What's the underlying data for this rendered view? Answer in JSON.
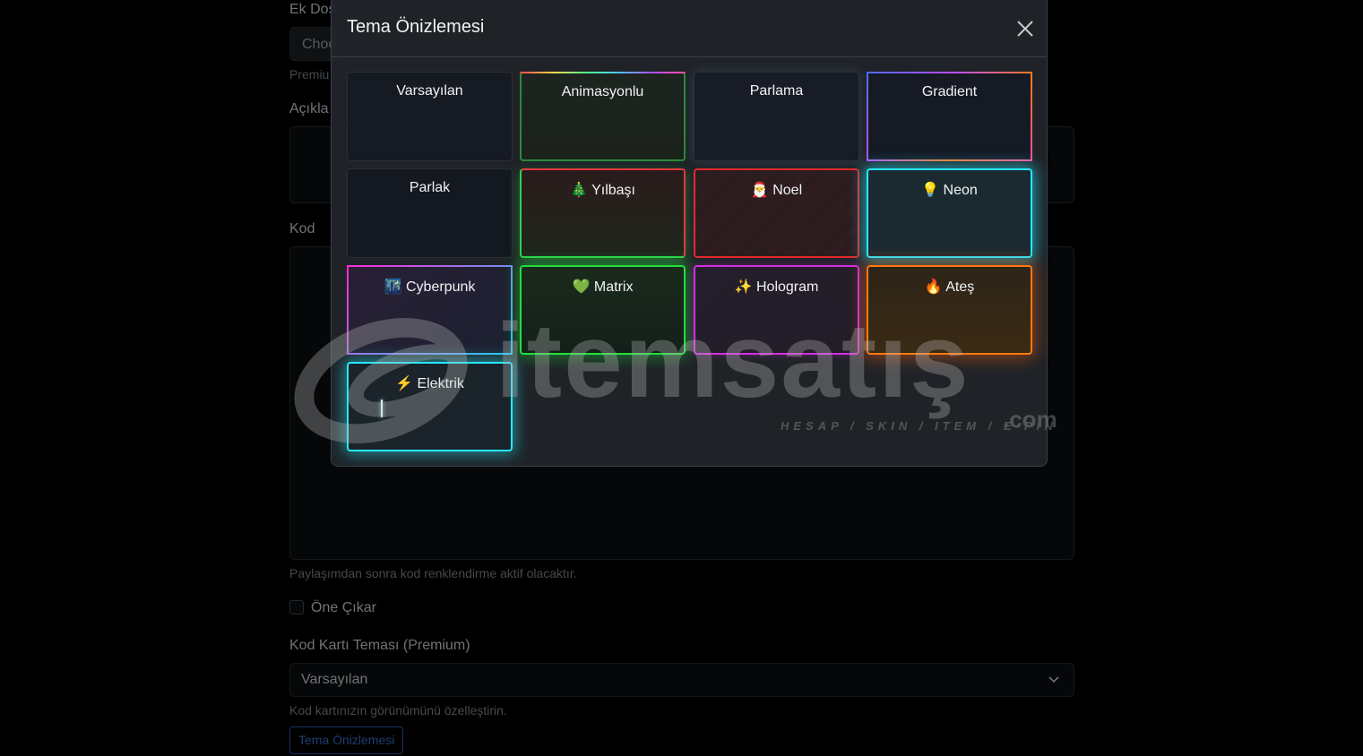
{
  "form": {
    "ek_dosya_label": "Ek Dos",
    "file_button": "Choo",
    "premium_help": "Premiu",
    "aciklama_label": "Açıkla",
    "kod_label": "Kod",
    "kod_help": "Paylaşımdan sonra kod renklendirme aktif olacaktır.",
    "one_cikar_label": "Öne Çıkar",
    "theme_label": "Kod Kartı Teması (Premium)",
    "theme_selected": "Varsayılan",
    "theme_help": "Kod kartınızın görünümünü özelleştirin.",
    "preview_button": "Tema Önizlemesi"
  },
  "watermark": {
    "word": "itemsatış",
    "tagline": "HESAP / SKIN / ITEM / E-PIN",
    "suffix": ".com"
  },
  "modal": {
    "title": "Tema Önizlemesi",
    "close_icon": "close-icon",
    "themes": [
      {
        "label": "Varsayılan"
      },
      {
        "label": "Animasyonlu"
      },
      {
        "label": "Parlama"
      },
      {
        "label": "Gradient"
      },
      {
        "label": "Parlak"
      },
      {
        "label": "🎄 Yılbaşı"
      },
      {
        "label": "🎅 Noel"
      },
      {
        "label": "💡 Neon"
      },
      {
        "label": "🌃 Cyberpunk"
      },
      {
        "label": "💚 Matrix"
      },
      {
        "label": "✨ Hologram"
      },
      {
        "label": "🔥 Ateş"
      },
      {
        "label": "⚡ Elektrik"
      }
    ]
  },
  "colors": {
    "neon": "#26e8ff",
    "matrix": "#22e03a",
    "hologram": "#d22ee0",
    "ates": "#ff7a12",
    "noel": "#e22a2a"
  }
}
